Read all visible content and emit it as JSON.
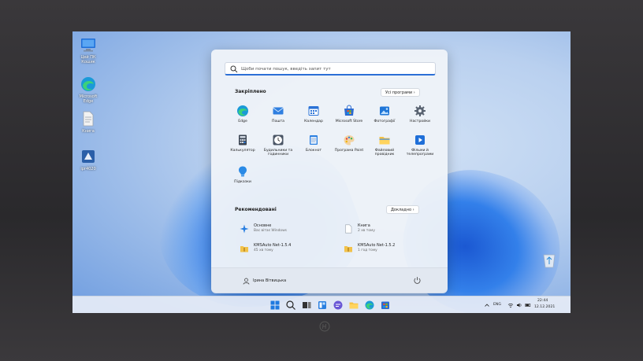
{
  "desktop": {
    "icons": [
      {
        "id": "this-pc",
        "label": "Цей ПК\nКошик",
        "icon": "monitor-icon"
      },
      {
        "id": "edge",
        "label": "Microsoft\nEdge",
        "icon": "edge-icon"
      },
      {
        "id": "file",
        "label": "Книга",
        "icon": "document-icon"
      },
      {
        "id": "app",
        "label": "ipr4020",
        "icon": "installer-icon"
      }
    ],
    "recycle_icon": "recycle-bin-icon"
  },
  "start_menu": {
    "search_placeholder": "Щоби почати пошук, введіть запит тут",
    "pinned_title": "Закріплено",
    "all_apps_label": "Усі програми  ›",
    "pinned": [
      {
        "name": "Edge",
        "icon": "edge-icon"
      },
      {
        "name": "Пошта",
        "icon": "mail-icon"
      },
      {
        "name": "Календар",
        "icon": "calendar-icon"
      },
      {
        "name": "Microsoft Store",
        "icon": "store-icon"
      },
      {
        "name": "Фотографії",
        "icon": "photos-icon"
      },
      {
        "name": "Настройки",
        "icon": "gear-icon"
      },
      {
        "name": "Калькулятор",
        "icon": "calculator-icon"
      },
      {
        "name": "Будильники та годинники",
        "icon": "clock-icon"
      },
      {
        "name": "Блокнот",
        "icon": "notepad-icon"
      },
      {
        "name": "Програма Paint",
        "icon": "paint-icon"
      },
      {
        "name": "Файловий провідник",
        "icon": "folder-icon"
      },
      {
        "name": "Фільми й телепрограми",
        "icon": "movies-icon"
      },
      {
        "name": "Підказки",
        "icon": "tips-icon"
      }
    ],
    "recommended_title": "Рекомендовані",
    "more_label": "Докладно  ›",
    "recommended": [
      {
        "title": "Основне",
        "subtitle": "Вас вітає Windows",
        "icon": "getstarted-icon"
      },
      {
        "title": "Книга",
        "subtitle": "2 хв тому",
        "icon": "document-icon"
      },
      {
        "title": "KMSAuto Net-1.5.4",
        "subtitle": "45 хв тому",
        "icon": "archive-icon"
      },
      {
        "title": "KMSAuto Net-1.5.2",
        "subtitle": "1 год тому",
        "icon": "archive-icon"
      }
    ],
    "user_name": "Ірина Вітвицька"
  },
  "taskbar": {
    "icons": [
      "windows-start-icon",
      "search-icon",
      "task-view-icon",
      "widgets-icon",
      "chat-icon",
      "file-explorer-icon",
      "edge-icon",
      "store-icon"
    ],
    "tray": {
      "language": "ENG",
      "time": "22:44",
      "date": "12.12.2021"
    }
  }
}
